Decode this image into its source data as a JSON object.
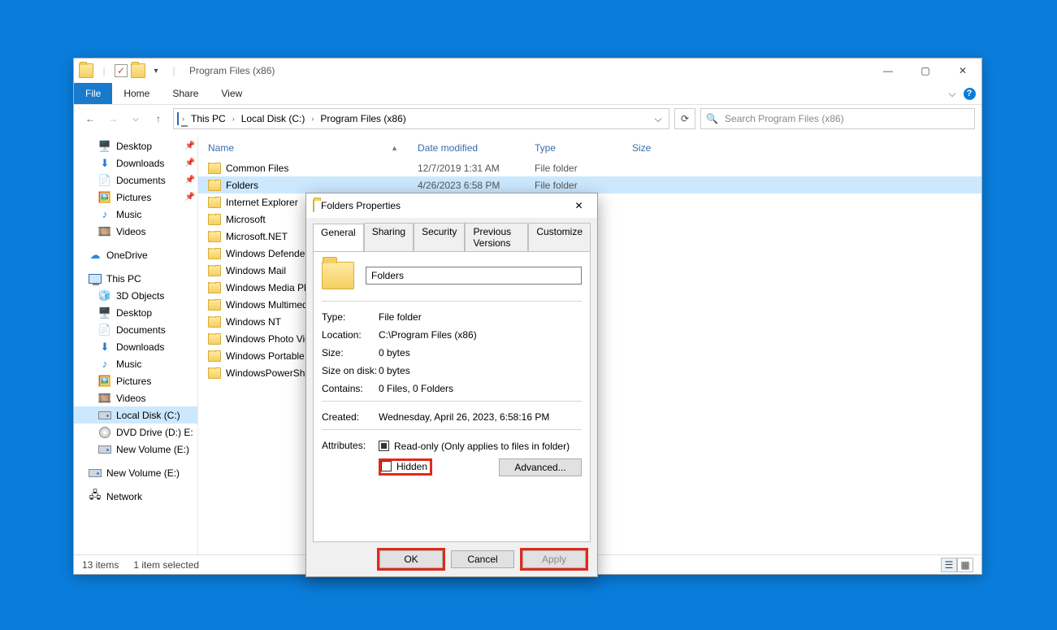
{
  "titlebar": {
    "title": "Program Files (x86)"
  },
  "controls": {
    "min": "—",
    "max": "▢",
    "close": "✕"
  },
  "ribbon": {
    "file": "File",
    "home": "Home",
    "share": "Share",
    "view": "View"
  },
  "breadcrumb": {
    "root_icon": "pc-icon",
    "segs": [
      "This PC",
      "Local Disk (C:)",
      "Program Files (x86)"
    ]
  },
  "search": {
    "placeholder": "Search Program Files (x86)"
  },
  "columns": {
    "name": "Name",
    "date": "Date modified",
    "type": "Type",
    "size": "Size"
  },
  "quick_access": {
    "items": [
      {
        "label": "Desktop",
        "pinned": true
      },
      {
        "label": "Downloads",
        "pinned": true
      },
      {
        "label": "Documents",
        "pinned": true
      },
      {
        "label": "Pictures",
        "pinned": true
      },
      {
        "label": "Music",
        "pinned": false
      },
      {
        "label": "Videos",
        "pinned": false
      }
    ]
  },
  "onedrive": {
    "label": "OneDrive"
  },
  "thispc": {
    "label": "This PC",
    "items": [
      "3D Objects",
      "Desktop",
      "Documents",
      "Downloads",
      "Music",
      "Pictures",
      "Videos",
      "Local Disk (C:)",
      "DVD Drive (D:) E:",
      "New Volume (E:)"
    ],
    "extra": "New Volume (E:)"
  },
  "network": {
    "label": "Network"
  },
  "status": {
    "count": "13 items",
    "selection": "1 item selected"
  },
  "rows": [
    {
      "name": "Common Files",
      "date": "12/7/2019 1:31 AM",
      "type": "File folder",
      "selected": false
    },
    {
      "name": "Folders",
      "date": "4/26/2023 6:58 PM",
      "type": "File folder",
      "selected": true
    },
    {
      "name": "Internet Explorer",
      "date": "",
      "type": "",
      "selected": false
    },
    {
      "name": "Microsoft",
      "date": "",
      "type": "",
      "selected": false
    },
    {
      "name": "Microsoft.NET",
      "date": "",
      "type": "",
      "selected": false
    },
    {
      "name": "Windows Defender",
      "date": "",
      "type": "",
      "selected": false
    },
    {
      "name": "Windows Mail",
      "date": "",
      "type": "",
      "selected": false
    },
    {
      "name": "Windows Media Player",
      "date": "",
      "type": "",
      "selected": false
    },
    {
      "name": "Windows Multimedia Platform",
      "date": "",
      "type": "",
      "selected": false
    },
    {
      "name": "Windows NT",
      "date": "",
      "type": "",
      "selected": false
    },
    {
      "name": "Windows Photo Viewer",
      "date": "",
      "type": "",
      "selected": false
    },
    {
      "name": "Windows Portable Devices",
      "date": "",
      "type": "",
      "selected": false
    },
    {
      "name": "WindowsPowerShell",
      "date": "",
      "type": "",
      "selected": false
    }
  ],
  "dialog": {
    "title": "Folders Properties",
    "tabs": {
      "general": "General",
      "sharing": "Sharing",
      "security": "Security",
      "previous": "Previous Versions",
      "customize": "Customize"
    },
    "name_value": "Folders",
    "labels": {
      "type": "Type:",
      "location": "Location:",
      "size": "Size:",
      "sizeondisk": "Size on disk:",
      "contains": "Contains:",
      "created": "Created:",
      "attributes": "Attributes:"
    },
    "values": {
      "type": "File folder",
      "location": "C:\\Program Files (x86)",
      "size": "0 bytes",
      "sizeondisk": "0 bytes",
      "contains": "0 Files, 0 Folders",
      "created": "Wednesday, April 26, 2023, 6:58:16 PM"
    },
    "attr": {
      "readonly": "Read-only (Only applies to files in folder)",
      "hidden": "Hidden",
      "advanced": "Advanced..."
    },
    "buttons": {
      "ok": "OK",
      "cancel": "Cancel",
      "apply": "Apply"
    }
  }
}
